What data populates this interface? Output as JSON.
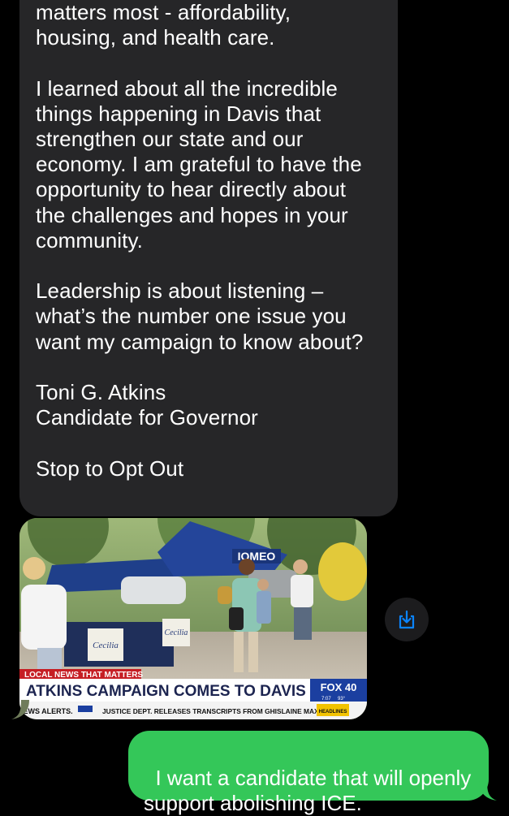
{
  "incoming_message": {
    "text": "matters most - affordability,\nhousing, and health care.\n\nI learned about all the incredible\nthings happening in Davis that\nstrengthen our state and our\neconomy. I am grateful to have the\nopportunity to hear directly about\nthe challenges and hopes in your\ncommunity.\n\nLeadership is about listening –\nwhat’s the number one issue you\nwant my campaign to know about?\n\nToni G. Atkins\nCandidate for Governor\n\nStop to Opt Out"
  },
  "media": {
    "tagline": "LOCAL NEWS THAT MATTERS",
    "headline": "ATKINS CAMPAIGN COMES TO DAVIS",
    "channel_logo": "FOX 40",
    "time": "7:07",
    "temperature": "93°",
    "ticker_left": "IEWS ALERTS.",
    "ticker_main": "JUSTICE DEPT. RELEASES TRANSCRIPTS FROM GHISLAINE MAXWELL'S",
    "ticker_badge": "HEADLINES",
    "tent_sign": "IOMEO",
    "sign_text_1": "Cecilia",
    "sign_text_2": "Cecilia"
  },
  "save_button": {
    "icon": "save-to-photos-icon"
  },
  "outgoing_message": {
    "text": "I want a candidate that will openly\nsupport abolishing ICE."
  },
  "colors": {
    "incoming_bubble": "#262628",
    "outgoing_bubble": "#34c759",
    "background": "#000000",
    "save_icon": "#0a84ff"
  }
}
